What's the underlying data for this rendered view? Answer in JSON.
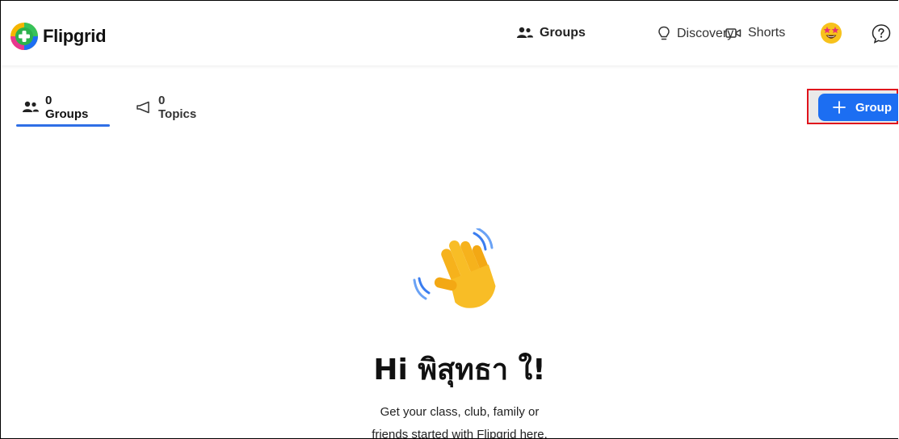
{
  "app": {
    "name": "Flipgrid"
  },
  "nav": {
    "groups": "Groups",
    "discovery": "Discovery",
    "shorts": "Shorts"
  },
  "icons": {
    "logo": "flipgrid-logo-icon",
    "groups": "people-icon",
    "discovery": "lightbulb-icon",
    "shorts": "video-camera-icon",
    "avatar": "star-struck-emoji-icon",
    "help": "help-question-icon",
    "topics": "megaphone-icon",
    "add": "plus-icon",
    "wave": "waving-hand-icon"
  },
  "tabs": {
    "groups": "0 Groups",
    "topics": "0 Topics"
  },
  "actions": {
    "add_group": "Group"
  },
  "empty_state": {
    "greeting": "Hi พิสุทธา ใ!",
    "line1": "Get your class, club, family or",
    "line2": "friends started with Flipgrid here."
  },
  "colors": {
    "accent": "#1c6ef2",
    "tab_underline": "#2f6fe6",
    "highlight_border": "#e0131c"
  }
}
